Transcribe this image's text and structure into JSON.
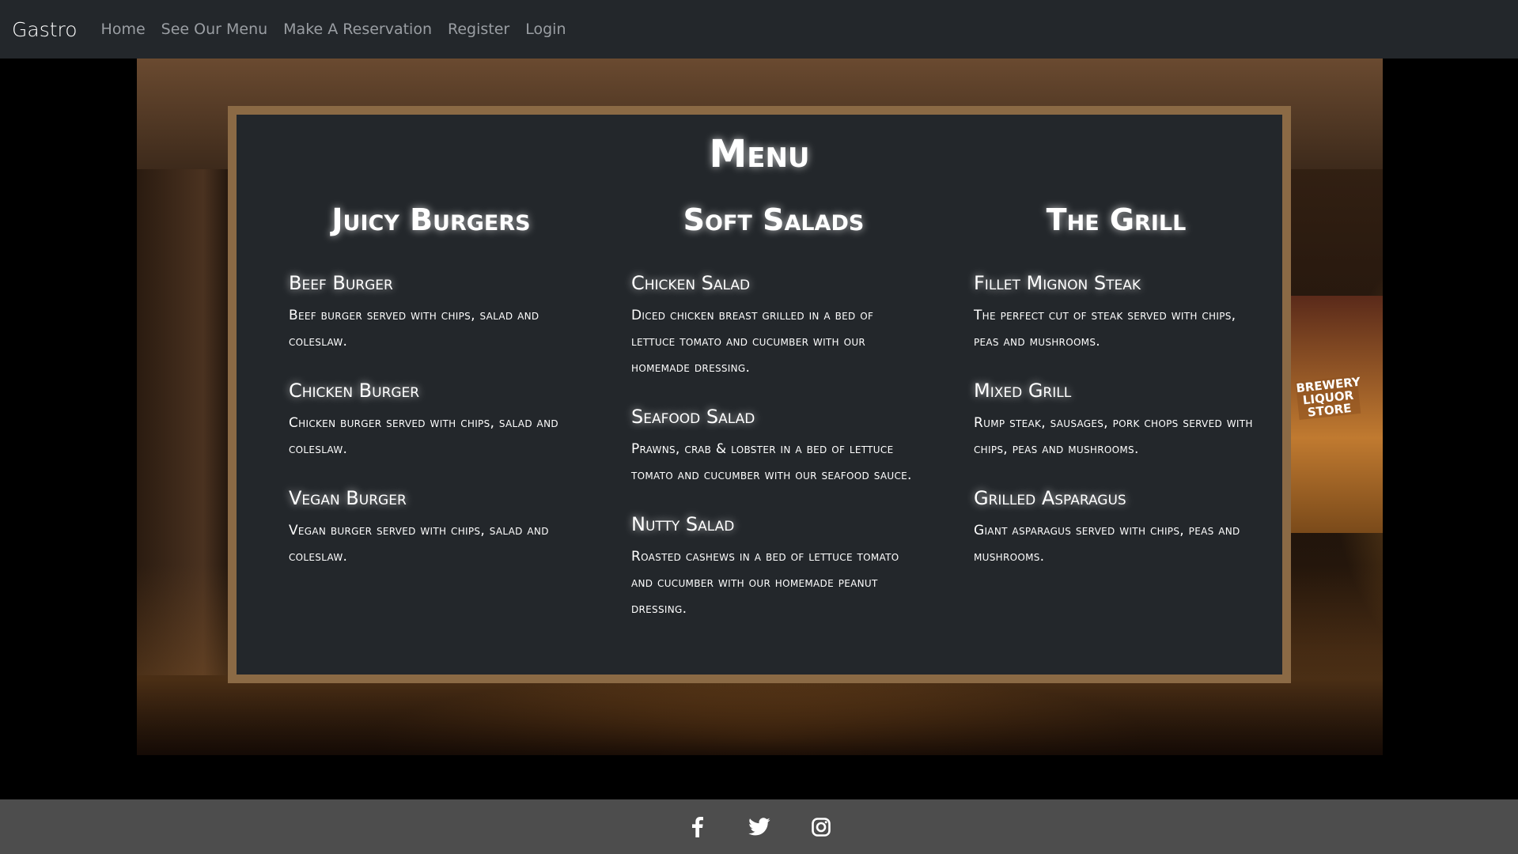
{
  "nav": {
    "brand": "Gastro",
    "links": [
      "Home",
      "See Our Menu",
      "Make A Reservation",
      "Register",
      "Login"
    ]
  },
  "hero": {
    "store_sign": "BREWERY LIQUOR STORE"
  },
  "menu": {
    "title": "Menu",
    "columns": [
      {
        "heading": "Juicy Burgers",
        "items": [
          {
            "name": "Beef Burger",
            "desc": "Beef burger served with chips, salad and coleslaw."
          },
          {
            "name": "Chicken Burger",
            "desc": "Chicken burger served with chips, salad and coleslaw."
          },
          {
            "name": "Vegan Burger",
            "desc": "Vegan burger served with chips, salad and coleslaw."
          }
        ]
      },
      {
        "heading": "Soft Salads",
        "items": [
          {
            "name": "Chicken Salad",
            "desc": "Diced chicken breast grilled in a bed of lettuce tomato and cucumber with our homemade dressing."
          },
          {
            "name": "Seafood Salad",
            "desc": "Prawns, crab & lobster in a bed of lettuce tomato and cucumber with our seafood sauce."
          },
          {
            "name": "Nutty Salad",
            "desc": "Roasted cashews in a bed of lettuce tomato and cucumber with our homemade peanut dressing."
          }
        ]
      },
      {
        "heading": "The Grill",
        "items": [
          {
            "name": "Fillet Mignon Steak",
            "desc": "The perfect cut of steak served with chips, peas and mushrooms."
          },
          {
            "name": "Mixed Grill",
            "desc": "Rump steak, sausages, pork chops served with chips, peas and mushrooms."
          },
          {
            "name": "Grilled Asparagus",
            "desc": "Giant asparagus served with chips, peas and mushrooms."
          }
        ]
      }
    ]
  },
  "footer": {
    "icons": [
      "facebook-icon",
      "twitter-icon",
      "instagram-icon"
    ]
  },
  "colors": {
    "navbar_bg": "#23272b",
    "card_bg": "#23272b",
    "card_border": "#8b6a45",
    "footer_bg": "#4d4d4d",
    "nav_link": "#9a9ea3"
  }
}
